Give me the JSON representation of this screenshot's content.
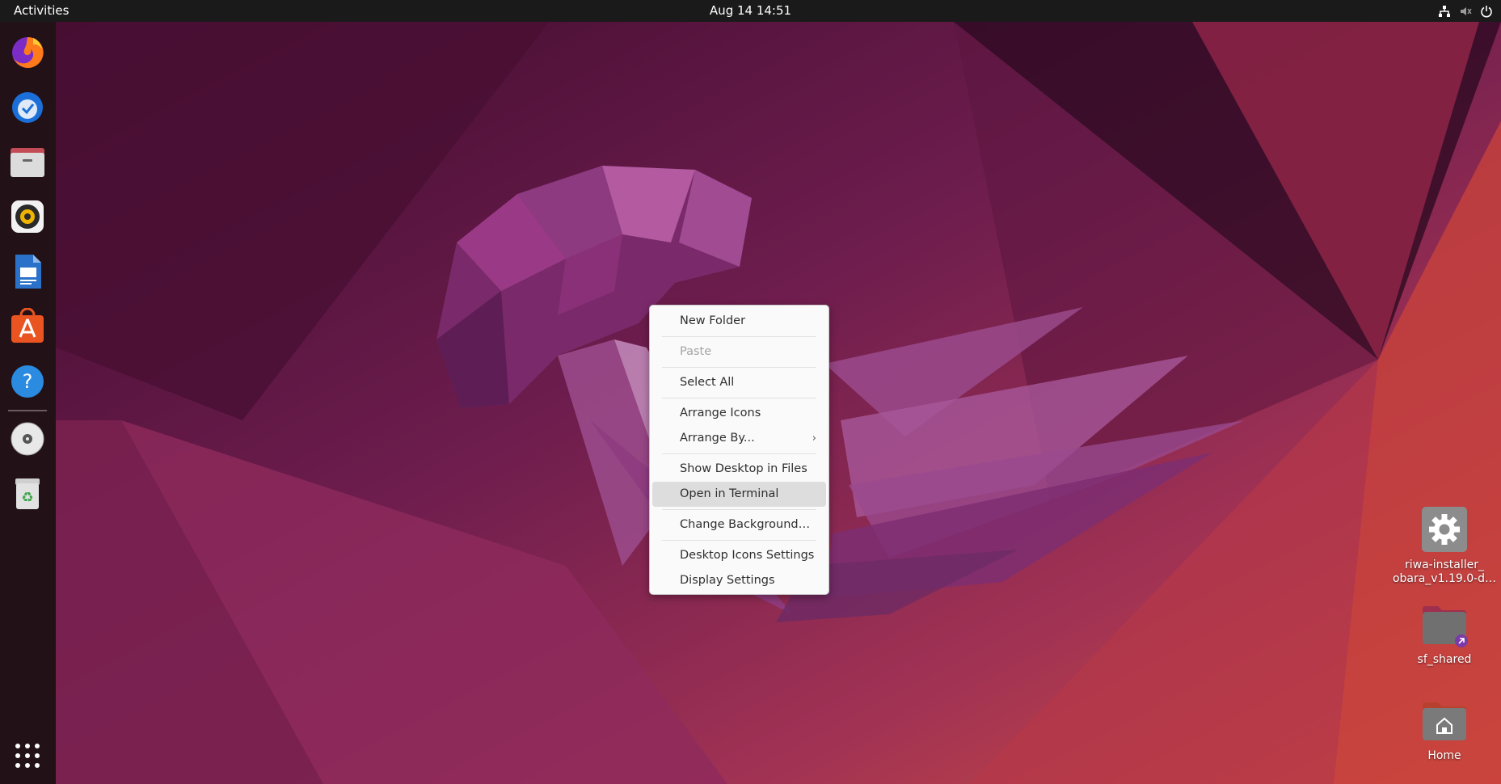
{
  "topbar": {
    "activities": "Activities",
    "clock": "Aug 14  14:51",
    "icons": [
      "network-icon",
      "volume-muted-icon",
      "power-icon"
    ]
  },
  "dock": {
    "apps": [
      {
        "name": "Firefox",
        "icon": "firefox-icon"
      },
      {
        "name": "Thunderbird Mail",
        "icon": "thunderbird-icon"
      },
      {
        "name": "Files",
        "icon": "files-icon"
      },
      {
        "name": "Rhythmbox",
        "icon": "rhythmbox-icon"
      },
      {
        "name": "LibreOffice Writer",
        "icon": "writer-icon"
      },
      {
        "name": "Ubuntu Software",
        "icon": "software-icon"
      },
      {
        "name": "Help",
        "icon": "help-icon"
      },
      {
        "name": "Disc",
        "icon": "disc-icon"
      },
      {
        "name": "Trash",
        "icon": "trash-icon"
      },
      {
        "name": "Show Applications",
        "icon": "app-grid-icon"
      }
    ]
  },
  "desktop": {
    "icons": [
      {
        "label": "riwa-installer_obara_v1.19.0-d…",
        "line1": "riwa-installer_",
        "line2": "obara_v1.19.0-d…",
        "icon": "gear-icon"
      },
      {
        "label": "sf_shared",
        "icon": "folder-link-icon"
      },
      {
        "label": "Home",
        "icon": "home-folder-icon"
      }
    ]
  },
  "context_menu": {
    "items": {
      "new_folder": "New Folder",
      "paste": "Paste",
      "select_all": "Select All",
      "arrange_icons": "Arrange Icons",
      "arrange_by": "Arrange By...",
      "show_desktop_in_files": "Show Desktop in Files",
      "open_in_terminal": "Open in Terminal",
      "change_background": "Change Background…",
      "desktop_icons_settings": "Desktop Icons Settings",
      "display_settings": "Display Settings"
    },
    "submenu_arrow": "›",
    "disabled": [
      "Paste"
    ],
    "highlighted": "Open in Terminal"
  },
  "colors": {
    "topbar": "#1b1a1a",
    "dock": "#221218",
    "menu_bg": "#fafafa",
    "highlight": "#dddddd"
  }
}
